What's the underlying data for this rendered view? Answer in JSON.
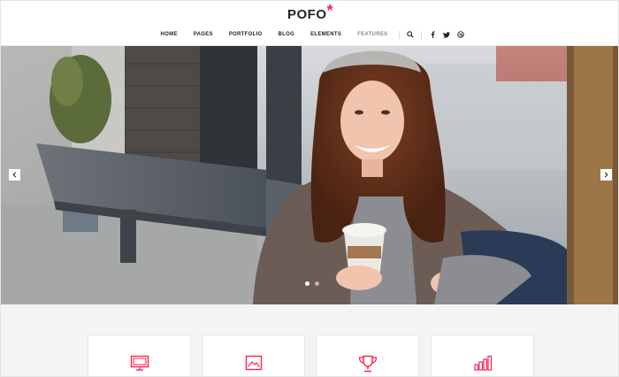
{
  "brand": {
    "name": "POFO",
    "mark": "*",
    "accent": "#ff214f"
  },
  "nav": {
    "items": [
      {
        "label": "HOME"
      },
      {
        "label": "PAGES"
      },
      {
        "label": "PORTFOLIO"
      },
      {
        "label": "BLOG"
      },
      {
        "label": "ELEMENTS"
      },
      {
        "label": "FEATURES"
      }
    ],
    "icons": [
      "search-icon",
      "facebook-icon",
      "twitter-icon",
      "dribbble-icon"
    ]
  },
  "slider": {
    "arrows": [
      "chevron-left-icon",
      "chevron-right-icon"
    ],
    "slide_count": 2,
    "active_slide": 1
  },
  "features": {
    "cards": [
      {
        "icon": "monitor-icon"
      },
      {
        "icon": "image-icon"
      },
      {
        "icon": "trophy-icon"
      },
      {
        "icon": "bar-chart-icon"
      }
    ]
  }
}
